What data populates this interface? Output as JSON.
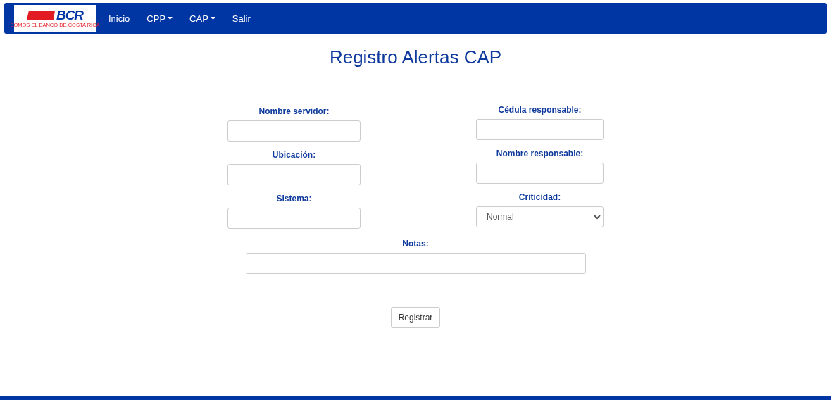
{
  "navbar": {
    "logo": {
      "text": "BCR",
      "tagline": "SOMOS EL BANCO DE COSTA RICA"
    },
    "items": [
      {
        "label": "Inicio",
        "kind": "link"
      },
      {
        "label": "CPP",
        "kind": "dropdown"
      },
      {
        "label": "CAP",
        "kind": "dropdown"
      },
      {
        "label": "Salir",
        "kind": "link"
      }
    ]
  },
  "title": "Registro Alertas CAP",
  "fields": [
    {
      "label": "Nombre servidor:",
      "kind": "text"
    },
    {
      "label": "Cédula responsable:",
      "kind": "text"
    },
    {
      "label": "Ubicación:",
      "kind": "text"
    },
    {
      "label": "Nombre responsable:",
      "kind": "text"
    },
    {
      "label": "Sistema:",
      "kind": "text"
    },
    {
      "label": "Criticidad:",
      "kind": "select",
      "value": "Normal"
    }
  ],
  "notes": {
    "label": "Notas:"
  },
  "submit": "Registrar"
}
